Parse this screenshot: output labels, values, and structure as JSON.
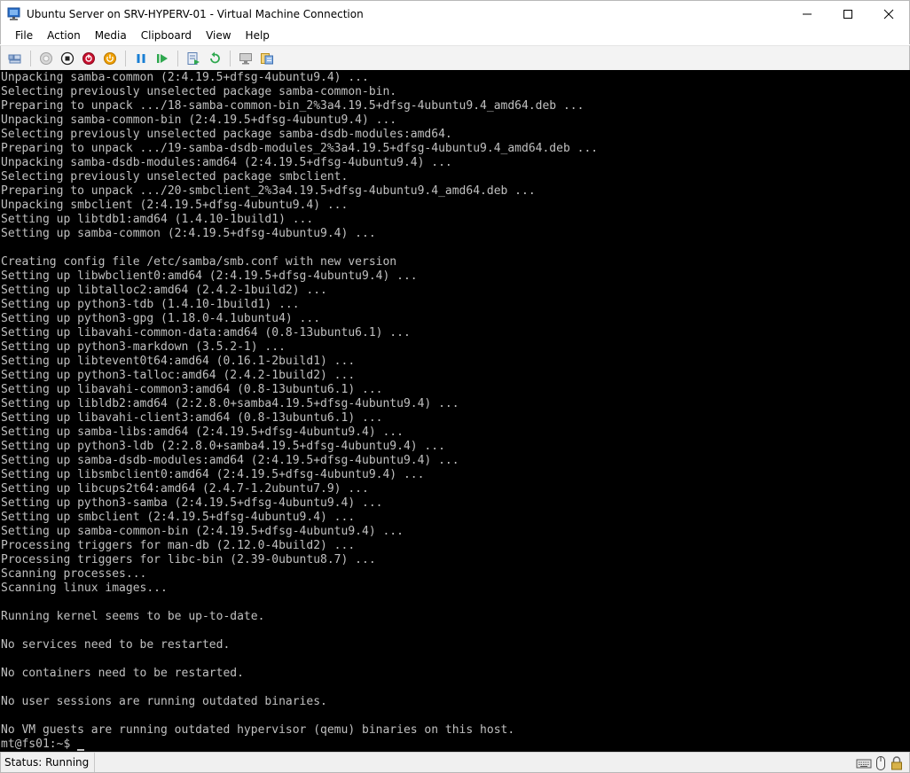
{
  "window": {
    "title": "Ubuntu Server on SRV-HYPERV-01 - Virtual Machine Connection",
    "icon": "vm-connection-icon"
  },
  "menu": [
    "File",
    "Action",
    "Media",
    "Clipboard",
    "View",
    "Help"
  ],
  "toolbar": {
    "icons": [
      "ctrl-alt-del-icon",
      "start-icon",
      "turn-off-icon",
      "shutdown-icon",
      "power-icon",
      "pause-icon",
      "resume-icon",
      "checkpoint-icon",
      "revert-icon",
      "enhanced-session-icon",
      "share-icon"
    ]
  },
  "console": {
    "lines": [
      "Unpacking samba-common (2:4.19.5+dfsg-4ubuntu9.4) ...",
      "Selecting previously unselected package samba-common-bin.",
      "Preparing to unpack .../18-samba-common-bin_2%3a4.19.5+dfsg-4ubuntu9.4_amd64.deb ...",
      "Unpacking samba-common-bin (2:4.19.5+dfsg-4ubuntu9.4) ...",
      "Selecting previously unselected package samba-dsdb-modules:amd64.",
      "Preparing to unpack .../19-samba-dsdb-modules_2%3a4.19.5+dfsg-4ubuntu9.4_amd64.deb ...",
      "Unpacking samba-dsdb-modules:amd64 (2:4.19.5+dfsg-4ubuntu9.4) ...",
      "Selecting previously unselected package smbclient.",
      "Preparing to unpack .../20-smbclient_2%3a4.19.5+dfsg-4ubuntu9.4_amd64.deb ...",
      "Unpacking smbclient (2:4.19.5+dfsg-4ubuntu9.4) ...",
      "Setting up libtdb1:amd64 (1.4.10-1build1) ...",
      "Setting up samba-common (2:4.19.5+dfsg-4ubuntu9.4) ...",
      "",
      "Creating config file /etc/samba/smb.conf with new version",
      "Setting up libwbclient0:amd64 (2:4.19.5+dfsg-4ubuntu9.4) ...",
      "Setting up libtalloc2:amd64 (2.4.2-1build2) ...",
      "Setting up python3-tdb (1.4.10-1build1) ...",
      "Setting up python3-gpg (1.18.0-4.1ubuntu4) ...",
      "Setting up libavahi-common-data:amd64 (0.8-13ubuntu6.1) ...",
      "Setting up python3-markdown (3.5.2-1) ...",
      "Setting up libtevent0t64:amd64 (0.16.1-2build1) ...",
      "Setting up python3-talloc:amd64 (2.4.2-1build2) ...",
      "Setting up libavahi-common3:amd64 (0.8-13ubuntu6.1) ...",
      "Setting up libldb2:amd64 (2:2.8.0+samba4.19.5+dfsg-4ubuntu9.4) ...",
      "Setting up libavahi-client3:amd64 (0.8-13ubuntu6.1) ...",
      "Setting up samba-libs:amd64 (2:4.19.5+dfsg-4ubuntu9.4) ...",
      "Setting up python3-ldb (2:2.8.0+samba4.19.5+dfsg-4ubuntu9.4) ...",
      "Setting up samba-dsdb-modules:amd64 (2:4.19.5+dfsg-4ubuntu9.4) ...",
      "Setting up libsmbclient0:amd64 (2:4.19.5+dfsg-4ubuntu9.4) ...",
      "Setting up libcups2t64:amd64 (2.4.7-1.2ubuntu7.9) ...",
      "Setting up python3-samba (2:4.19.5+dfsg-4ubuntu9.4) ...",
      "Setting up smbclient (2:4.19.5+dfsg-4ubuntu9.4) ...",
      "Setting up samba-common-bin (2:4.19.5+dfsg-4ubuntu9.4) ...",
      "Processing triggers for man-db (2.12.0-4build2) ...",
      "Processing triggers for libc-bin (2.39-0ubuntu8.7) ...",
      "Scanning processes...",
      "Scanning linux images...",
      "",
      "Running kernel seems to be up-to-date.",
      "",
      "No services need to be restarted.",
      "",
      "No containers need to be restarted.",
      "",
      "No user sessions are running outdated binaries.",
      "",
      "No VM guests are running outdated hypervisor (qemu) binaries on this host."
    ],
    "prompt": "mt@fs01:~$ "
  },
  "status": {
    "text": "Status: Running",
    "icons": [
      "keyboard-icon",
      "mouse-icon",
      "lock-icon"
    ]
  },
  "colors": {
    "console_bg": "#000000",
    "console_fg": "#c0c0c0",
    "chrome_bg": "#ffffff",
    "toolbar_bg": "#f3f3f3"
  }
}
